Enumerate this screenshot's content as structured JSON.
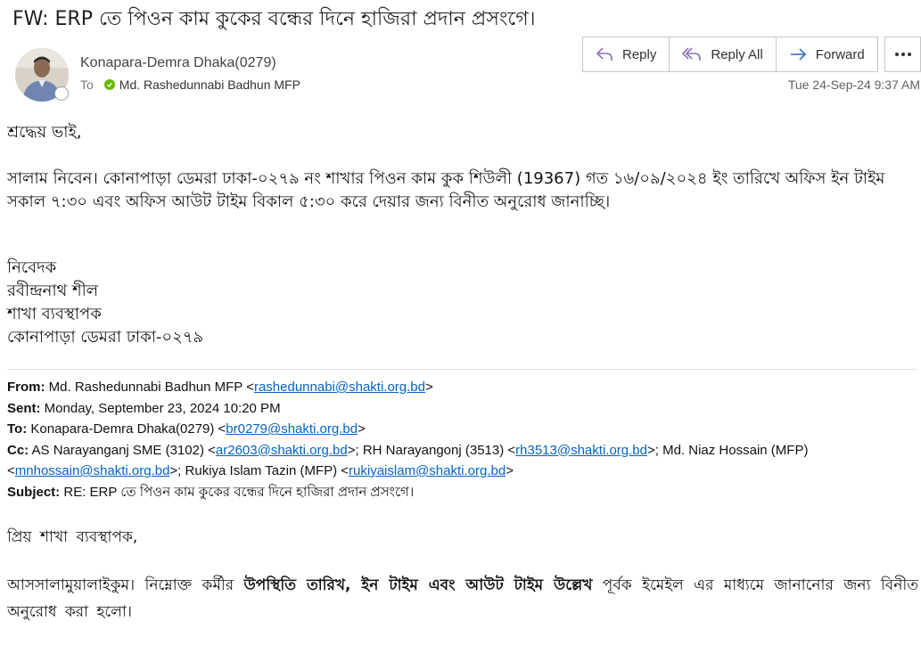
{
  "email": {
    "subject": "FW: ERP তে পিওন কাম কুকের বন্ধের দিনে হাজিরা প্রদান প্রসংগে।",
    "sender": "Konapara-Demra Dhaka(0279)",
    "to_label": "To",
    "recipient": "Md. Rashedunnabi Badhun MFP",
    "date": "Tue 24-Sep-24 9:37 AM"
  },
  "toolbar": {
    "reply": "Reply",
    "reply_all": "Reply All",
    "forward": "Forward",
    "more_icon": "ellipsis-icon"
  },
  "body": {
    "greeting": "শ্রদ্ধেয় ভাই,",
    "para_line1": "সালাম নিবেন। কোনাপাড়া ডেমরা ঢাকা-০২৭৯ নং শাখার পিওন কাম কুক শিউলী (19367) গত ১৬/০৯/২০২৪ ইং তারিখে অফিস ইন টাইম",
    "para_line2": "সকাল ৭:৩০ এবং অফিস আউট টাইম বিকাল ৫:৩০ করে দেয়ার জন্য বিনীত অনুরোধ জানাচ্ছি।",
    "sig1": "নিবেদক",
    "sig2": "রবীন্দ্রনাথ শীল",
    "sig3": "শাখা ব্যবস্থাপক",
    "sig4": "কোনাপাড়া ডেমরা ঢাকা-০২৭৯"
  },
  "forwarded": {
    "from_label": "From:",
    "from_name": "Md. Rashedunnabi Badhun MFP <",
    "from_email": "rashedunnabi@shakti.org.bd",
    "sent_label": "Sent:",
    "sent_value": "Monday, September 23, 2024 10:20 PM",
    "to_label": "To:",
    "to_name": "Konapara-Demra Dhaka(0279) <",
    "to_email": "br0279@shakti.org.bd",
    "cc_label": "Cc:",
    "cc1_name": "AS Narayanganj SME (3102) <",
    "cc1_email": "ar2603@shakti.org.bd",
    "cc2_name": ">; RH Narayangonj (3513) <",
    "cc2_email": "rh3513@shakti.org.bd",
    "cc3_name": ">; Md. Niaz Hossain (MFP)",
    "cc3_email": "mnhossain@shakti.org.bd",
    "cc4_name": ">; Rukiya Islam Tazin (MFP) <",
    "cc4_email": "rukiyaislam@shakti.org.bd",
    "subject_label": "Subject:",
    "subject_value": "RE: ERP তে পিওন কাম কুকের বন্ধের দিনে হাজিরা প্রদান প্রসংগে।",
    "greeting": "প্রিয় শাখা ব্যবস্থাপক,",
    "msg_start": "আসসালামুয়ালাইকুম। নিম্নোক্ত কর্মীর",
    "msg_bold": "উপস্থিতি তারিখ, ইন টাইম এবং আউট টাইম উল্লেখ",
    "msg_end": "পূর্বক ইমেইল এর মাধ্যমে জানানোর জন্য বিনীত",
    "msg_line2": "অনুরোধ করা হলো।"
  }
}
